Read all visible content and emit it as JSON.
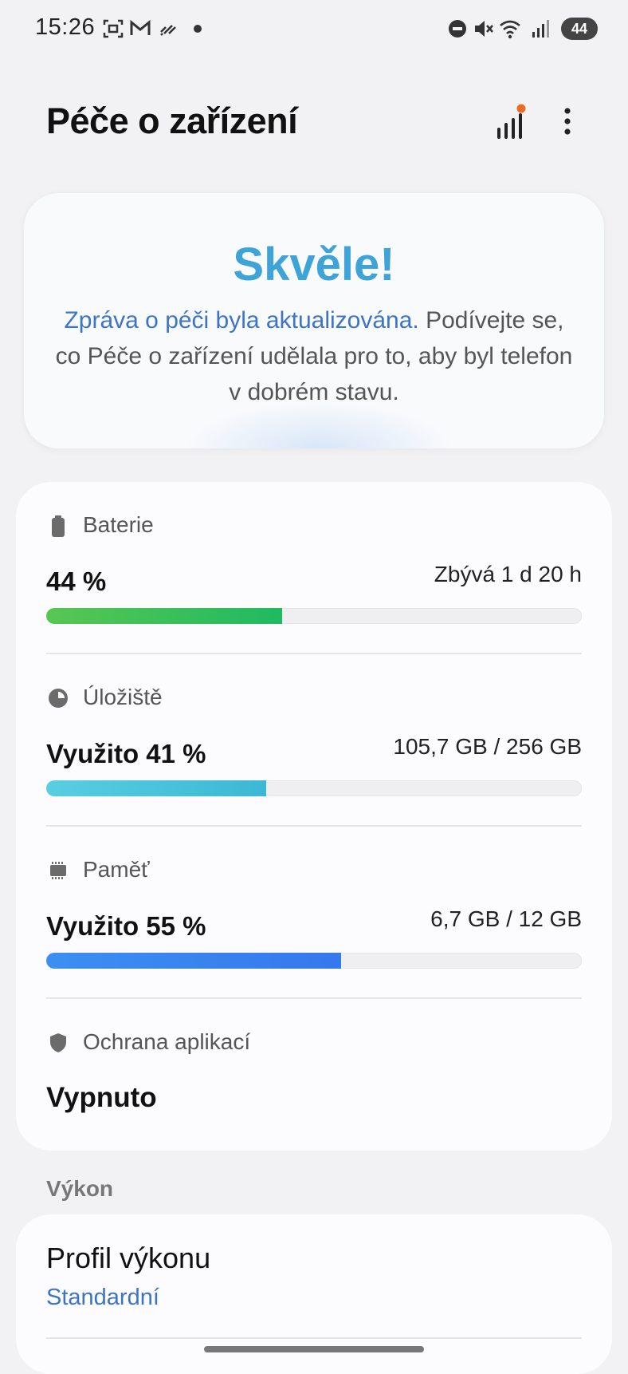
{
  "status_bar": {
    "time": "15:26",
    "battery_level": "44",
    "icons": [
      "screenshot-icon",
      "gmail-icon",
      "stylus-icon",
      "dot-icon",
      "do-not-disturb-icon",
      "mute-icon",
      "wifi-icon",
      "signal-icon"
    ]
  },
  "header": {
    "title": "Péče o zařízení",
    "report_icon": "bar-chart-icon",
    "more_icon": "more-vert-icon"
  },
  "hero": {
    "heading": "Skvěle!",
    "link_text": "Zpráva o péči byla aktualizována.",
    "text": " Podívejte se, co Péče o zařízení udělala pro to, aby byl telefon v dobrém stavu."
  },
  "battery": {
    "label": "Baterie",
    "value": "44 %",
    "detail": "Zbývá 1 d 20 h",
    "level": 0.44,
    "color_start": "#58c653",
    "color_end": "#1fba61"
  },
  "storage": {
    "label": "Úložiště",
    "value": "Využito 41 %",
    "detail": "105,7 GB / 256 GB",
    "level": 0.41,
    "color_start": "#58cfe0",
    "color_end": "#3bb8d6"
  },
  "memory": {
    "label": "Paměť",
    "value": "Využito 55 %",
    "detail": "6,7 GB / 12 GB",
    "level": 0.55,
    "color_start": "#3c8ff0",
    "color_end": "#3678ee"
  },
  "app_protection": {
    "label": "Ochrana aplikací",
    "value": "Vypnuto"
  },
  "performance": {
    "section_label": "Výkon",
    "profile_title": "Profil výkonu",
    "profile_value": "Standardní"
  }
}
